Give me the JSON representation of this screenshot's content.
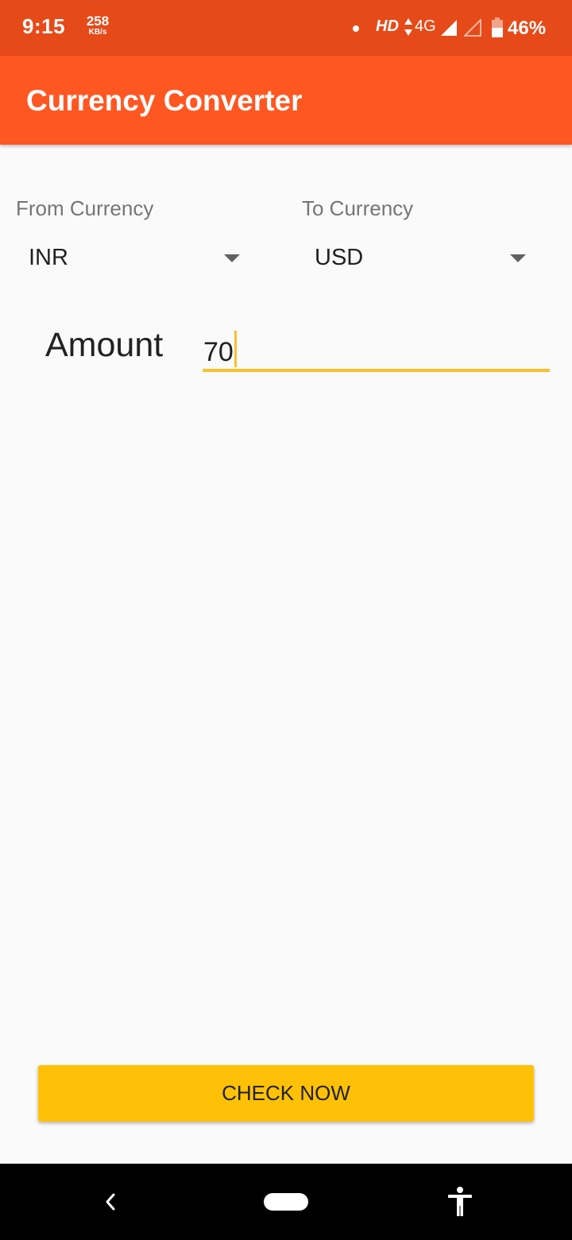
{
  "status_bar": {
    "time": "9:15",
    "speed_value": "258",
    "speed_unit": "KB/s",
    "hd_label": "HD",
    "network_label": "4G",
    "battery_percent": "46%",
    "icons": [
      "notification-dot-icon",
      "data-arrows-icon",
      "signal-icon",
      "signal-empty-icon",
      "battery-icon"
    ]
  },
  "app_bar": {
    "title": "Currency Converter"
  },
  "form": {
    "from_label": "From Currency",
    "from_value": "INR",
    "to_label": "To Currency",
    "to_value": "USD",
    "amount_label": "Amount",
    "amount_value": "70"
  },
  "actions": {
    "check_label": "CHECK NOW"
  },
  "colors": {
    "status_bar": "#e64a19",
    "app_bar": "#ff5722",
    "accent": "#fbc02d",
    "button": "#ffc107"
  },
  "nav_bar": {
    "icons": [
      "back-icon",
      "home-pill-icon",
      "accessibility-icon"
    ]
  }
}
